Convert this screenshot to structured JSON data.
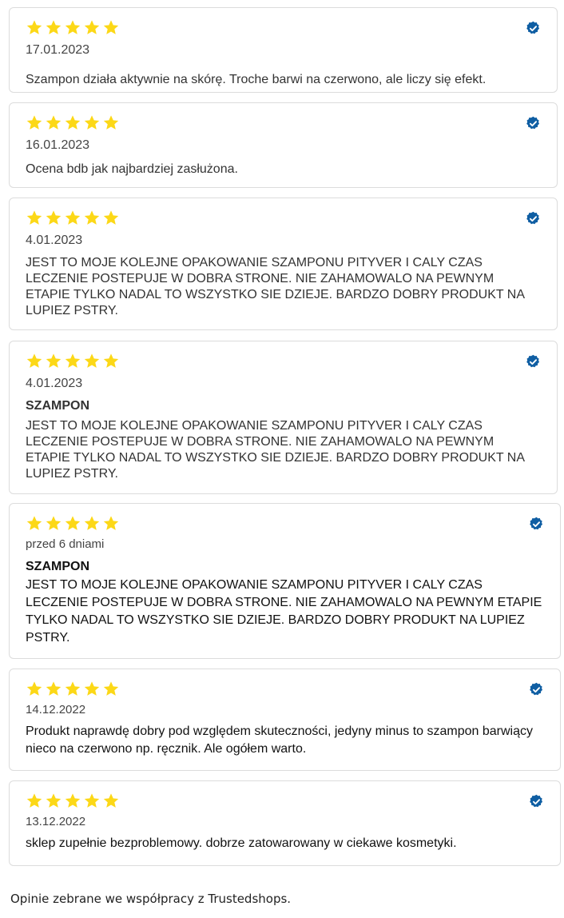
{
  "colors": {
    "star": "#fcd817",
    "verified": "#0f5ea3",
    "border": "#dcdcdc"
  },
  "icons": {
    "star": "star-icon",
    "verified": "verified-badge-icon"
  },
  "reviews": [
    {
      "rating": 5,
      "date": "17.01.2023",
      "title": "",
      "text": "Szampon działa aktywnie na skórę. Troche barwi na czerwono, ale liczy się efekt."
    },
    {
      "rating": 5,
      "date": "16.01.2023",
      "title": "",
      "text": "Ocena bdb jak najbardziej zasłużona."
    },
    {
      "rating": 5,
      "date": "4.01.2023",
      "title": "",
      "text": "JEST TO MOJE KOLEJNE OPAKOWANIE SZAMPONU PITYVER I CALY CZAS LECZENIE POSTEPUJE W DOBRA STRONE. NIE ZAHAMOWALO NA PEWNYM ETAPIE TYLKO NADAL TO WSZYSTKO SIE DZIEJE. BARDZO DOBRY PRODUKT NA LUPIEZ PSTRY."
    },
    {
      "rating": 5,
      "date": "4.01.2023",
      "title": "SZAMPON",
      "text": "JEST TO MOJE KOLEJNE OPAKOWANIE SZAMPONU PITYVER I CALY CZAS LECZENIE POSTEPUJE W DOBRA STRONE. NIE ZAHAMOWALO NA PEWNYM ETAPIE TYLKO NADAL TO WSZYSTKO SIE DZIEJE. BARDZO DOBRY PRODUKT NA LUPIEZ PSTRY."
    },
    {
      "rating": 5,
      "date": "przed 6 dniami",
      "title": "SZAMPON",
      "text": "JEST TO MOJE KOLEJNE OPAKOWANIE SZAMPONU PITYVER I CALY CZAS LECZENIE POSTEPUJE W DOBRA STRONE. NIE ZAHAMOWALO NA PEWNYM ETAPIE TYLKO NADAL TO WSZYSTKO SIE DZIEJE. BARDZO DOBRY PRODUKT NA LUPIEZ PSTRY."
    },
    {
      "rating": 5,
      "date": "14.12.2022",
      "title": "",
      "text": "Produkt naprawdę dobry pod względem skuteczności, jedyny minus to szampon barwiący nieco na czerwono np. ręcznik. Ale ogółem warto."
    },
    {
      "rating": 5,
      "date": "13.12.2022",
      "title": "",
      "text": "sklep zupełnie bezproblemowy. dobrze zatowarowany w ciekawe kosmetyki."
    }
  ],
  "footer": {
    "text": "Opinie zebrane we współpracy z Trustedshops."
  }
}
